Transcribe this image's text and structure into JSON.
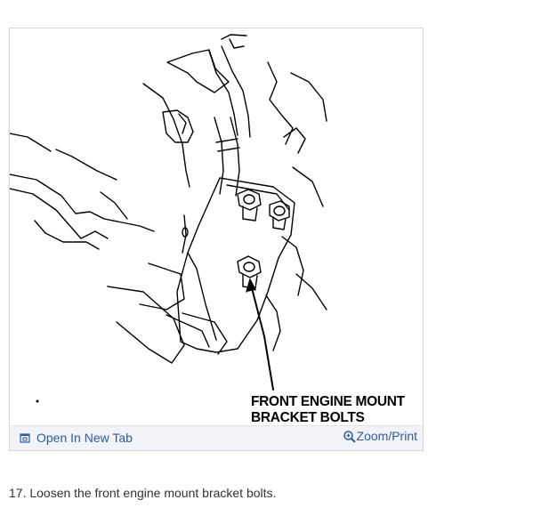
{
  "figure": {
    "label_lines": [
      "FRONT ENGINE MOUNT",
      "BRACKET BOLTS"
    ],
    "toolbar": {
      "open_tab_label": "Open In New Tab",
      "open_tab_icon": "external-window-icon",
      "zoom_label": "Zoom/Print",
      "zoom_icon": "magnifier-plus-icon",
      "link_color": "#2d5c9e"
    }
  },
  "caption": "17. Loosen the front engine mount bracket bolts."
}
